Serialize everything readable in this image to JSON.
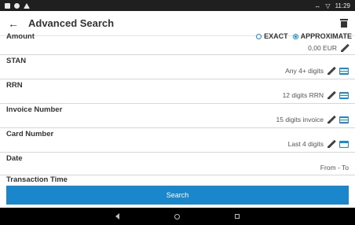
{
  "status_bar": {
    "time": "11:29"
  },
  "app_bar": {
    "title": "Advanced Search"
  },
  "amount": {
    "label": "Amount",
    "options": [
      {
        "label": "EXACT",
        "selected": false
      },
      {
        "label": "APPROXIMATE",
        "selected": true
      }
    ],
    "value": "0,00 EUR"
  },
  "fields": [
    {
      "label": "STAN",
      "value": "Any 4+ digits",
      "icon": "card-icon"
    },
    {
      "label": "RRN",
      "value": "12 digits RRN",
      "icon": "card-icon"
    },
    {
      "label": "Invoice Number",
      "value": "15 digits invoice",
      "icon": "card-icon"
    },
    {
      "label": "Card Number",
      "value": "Last 4 digits",
      "icon": "credit-card-icon"
    }
  ],
  "date": {
    "label": "Date",
    "value": "From - To"
  },
  "partial_label": "Transaction Time",
  "search_button": {
    "label": "Search"
  },
  "colors": {
    "accent": "#1a86cc",
    "status_bar": "#1f1f1f",
    "nav_bar": "#000000"
  }
}
